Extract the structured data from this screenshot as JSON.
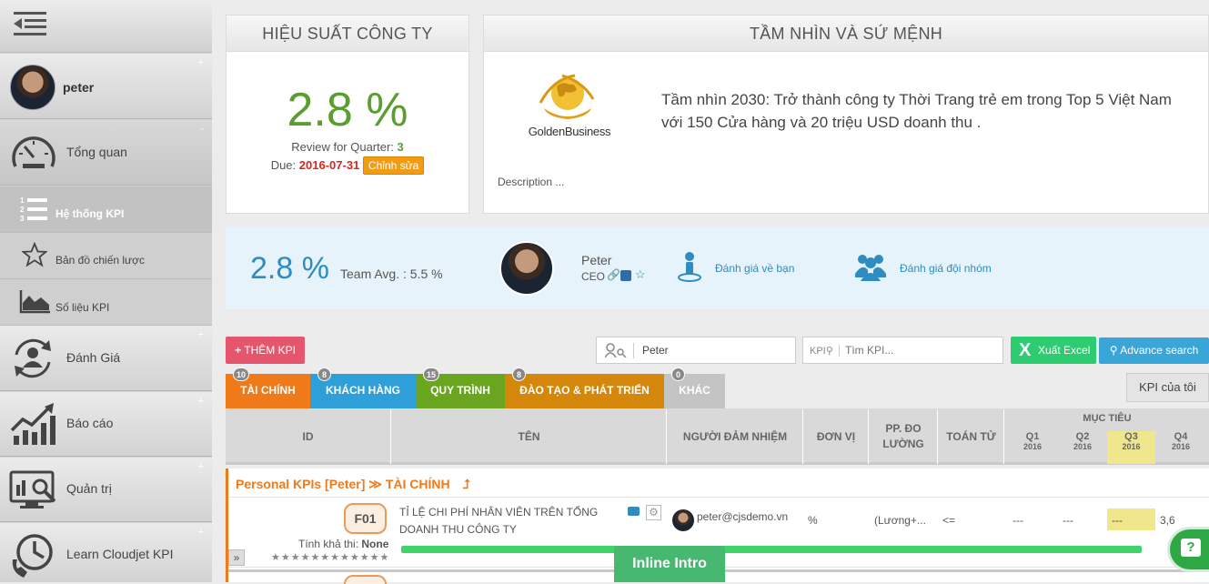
{
  "sidebar": {
    "user": {
      "name": "peter"
    },
    "items": [
      {
        "label": "Tổng quan"
      },
      {
        "label": "Đánh Giá"
      },
      {
        "label": "Báo cáo"
      },
      {
        "label": "Quản trị"
      },
      {
        "label": "Learn Cloudjet KPI"
      }
    ],
    "subitems": [
      {
        "label": "Hệ thống KPI"
      },
      {
        "label": "Bản đồ chiến lược"
      },
      {
        "label": "Số liệu KPI"
      }
    ]
  },
  "performance": {
    "title": "HIỆU SUẤT CÔNG TY",
    "value": "2.8 %",
    "review_label": "Review for Quarter:",
    "quarter": "3",
    "due_label": "Due:",
    "due_date": "2016-07-31",
    "edit_label": "Chỉnh sửa"
  },
  "vision": {
    "title": "TẦM NHÌN VÀ SỨ MỆNH",
    "logo_text": "GoldenBusiness",
    "text": "Tầm nhìn 2030: Trở thành công ty Thời Trang trẻ em trong Top 5 Việt Nam với 150 Cửa hàng và 20 triệu USD doanh thu .",
    "description": "Description ..."
  },
  "summary": {
    "score": "2.8 %",
    "team_avg": "Team Avg. : 5.5 %",
    "person_name": "Peter",
    "person_role": "CEO",
    "self_review": "Đánh giá về bạn",
    "team_review": "Đánh giá đội nhóm"
  },
  "toolbar": {
    "add_kpi": "THÊM KPI",
    "user_search_value": "Peter",
    "kpi_prefix": "KPI",
    "kpi_search_placeholder": "Tìm KPI...",
    "export_excel": "Xuất Excel",
    "advance_search": "Advance search",
    "my_kpi": "KPI của tôi"
  },
  "tabs": [
    {
      "label": "TÀI CHÍNH",
      "count": "10",
      "color": "#f07a1a"
    },
    {
      "label": "KHÁCH HÀNG",
      "count": "8",
      "color": "#2e9fd8"
    },
    {
      "label": "QUY TRÌNH",
      "count": "15",
      "color": "#6aa51f"
    },
    {
      "label": "ĐÀO TẠO & PHÁT TRIỂN",
      "count": "8",
      "color": "#d4870a"
    },
    {
      "label": "KHÁC",
      "count": "0",
      "color": "#c4c4c4"
    }
  ],
  "table": {
    "headers": {
      "id": "ID",
      "name": "TÊN",
      "owner": "NGƯỜI ĐẢM NHIỆM",
      "unit": "ĐƠN VỊ",
      "measure": "PP. ĐO LƯỜNG",
      "operator": "TOÁN TỬ",
      "target": "MỤC TIÊU",
      "quarters": [
        {
          "q": "Q1",
          "year": "2016"
        },
        {
          "q": "Q2",
          "year": "2016"
        },
        {
          "q": "Q3",
          "year": "2016"
        },
        {
          "q": "Q4",
          "year": "2016"
        }
      ]
    },
    "group_title": "Personal KPIs [Peter] ≫ TÀI CHÍNH",
    "rows": [
      {
        "id": "F01",
        "feasibility_label": "Tính khả thi:",
        "feasibility": "None",
        "stars": "★★★★★★★★★★★★",
        "name": "TỈ LỆ CHI PHÍ NHÂN VIÊN TRÊN TỔNG DOANH THU CÔNG TY",
        "owner": "peter@cjsdemo.vn",
        "unit": "%",
        "measure": "(Lương+...",
        "operator": "<=",
        "q1": "---",
        "q2": "---",
        "q3": "---",
        "q4": "3,6"
      }
    ],
    "expand": "»"
  },
  "inline_intro": "Inline Intro",
  "colors": {
    "green": "#5a9e2f",
    "red": "#d9261c",
    "orange": "#f39c12",
    "pink": "#e5566c",
    "highlight": "#f0e68c"
  }
}
